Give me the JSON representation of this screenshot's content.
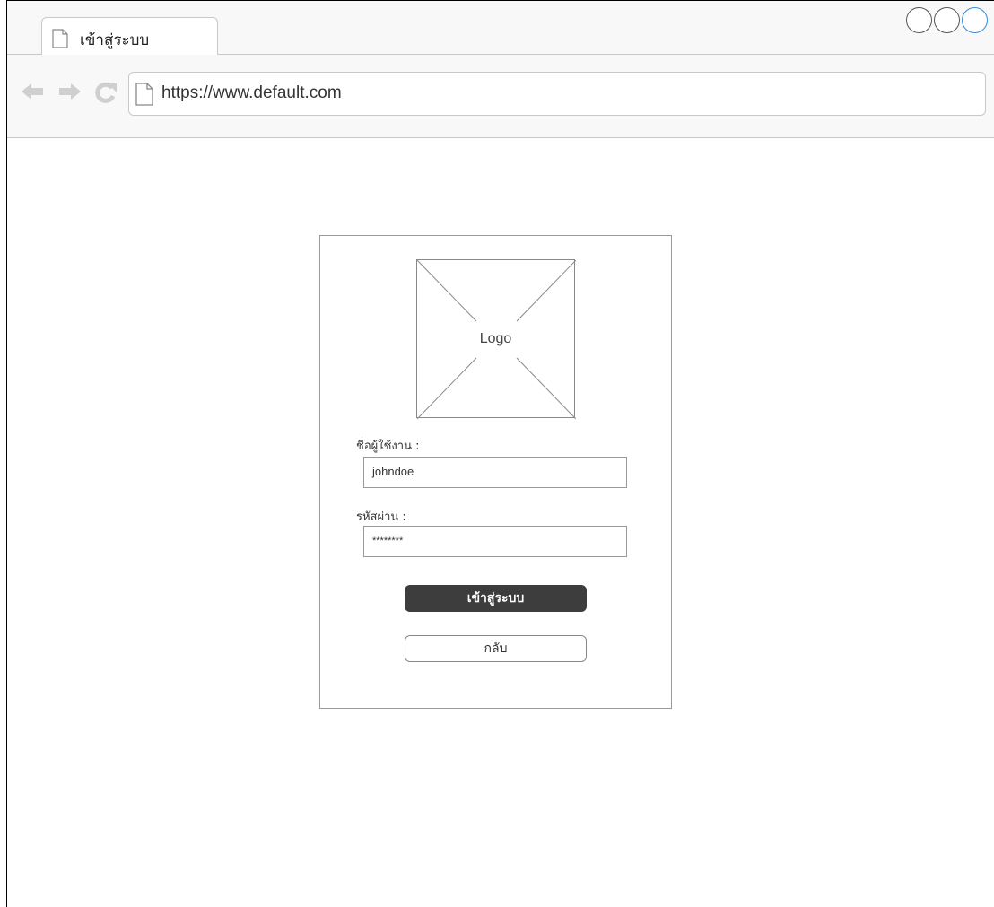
{
  "browser": {
    "tab_title": "เข้าสู่ระบบ",
    "url": "https://www.default.com",
    "nav_icons": [
      "back-arrow-icon",
      "forward-arrow-icon",
      "refresh-icon"
    ]
  },
  "login": {
    "logo_text": "Logo",
    "username_label": "ชื่อผู้ใช้งาน :",
    "username_value": "johndoe",
    "password_label": "รหัสผ่าน :",
    "password_value": "********",
    "login_button": "เข้าสู่ระบบ",
    "back_button": "กลับ"
  },
  "colors": {
    "primary_button": "#3d3d3d",
    "accent_window_button": "#3b8bd8"
  }
}
